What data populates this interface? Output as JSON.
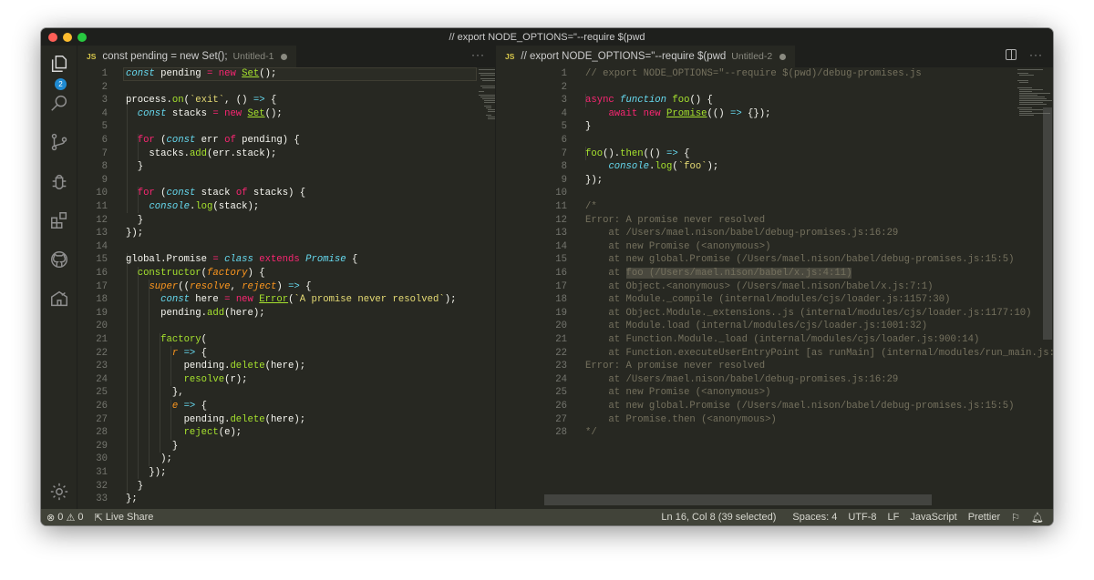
{
  "window": {
    "title": "// export NODE_OPTIONS=\"--require $(pwd"
  },
  "activity": {
    "explorer_badge": "2"
  },
  "left_tab": {
    "title": "const pending = new Set();",
    "desc": "Untitled-1",
    "lang": "JS",
    "more": "···"
  },
  "right_tab": {
    "title": "// export NODE_OPTIONS=\"--require $(pwd",
    "desc": "Untitled-2",
    "lang": "JS",
    "more": "···"
  },
  "left_lines": [
    "1",
    "2",
    "3",
    "4",
    "5",
    "6",
    "7",
    "8",
    "9",
    "10",
    "11",
    "12",
    "13",
    "14",
    "15",
    "16",
    "17",
    "18",
    "19",
    "20",
    "21",
    "22",
    "23",
    "24",
    "25",
    "26",
    "27",
    "28",
    "29",
    "30",
    "31",
    "32",
    "33"
  ],
  "right_lines": [
    "1",
    "2",
    "3",
    "4",
    "5",
    "6",
    "7",
    "8",
    "9",
    "10",
    "11",
    "12",
    "13",
    "14",
    "15",
    "16",
    "17",
    "18",
    "19",
    "20",
    "21",
    "22",
    "23",
    "24",
    "25",
    "26",
    "27",
    "28"
  ],
  "status": {
    "errors": "0",
    "warnings": "0",
    "live_share": "Live Share",
    "position": "Ln 16, Col 8 (39 selected)",
    "spaces": "Spaces: 4",
    "encoding": "UTF-8",
    "eol": "LF",
    "language": "JavaScript",
    "formatter": "Prettier"
  },
  "colors": {
    "editor_bg": "#272822",
    "keyword": "#f92672",
    "function": "#a6e22e",
    "string": "#e6db74",
    "comment": "#75715e",
    "storage": "#66d9ef"
  }
}
